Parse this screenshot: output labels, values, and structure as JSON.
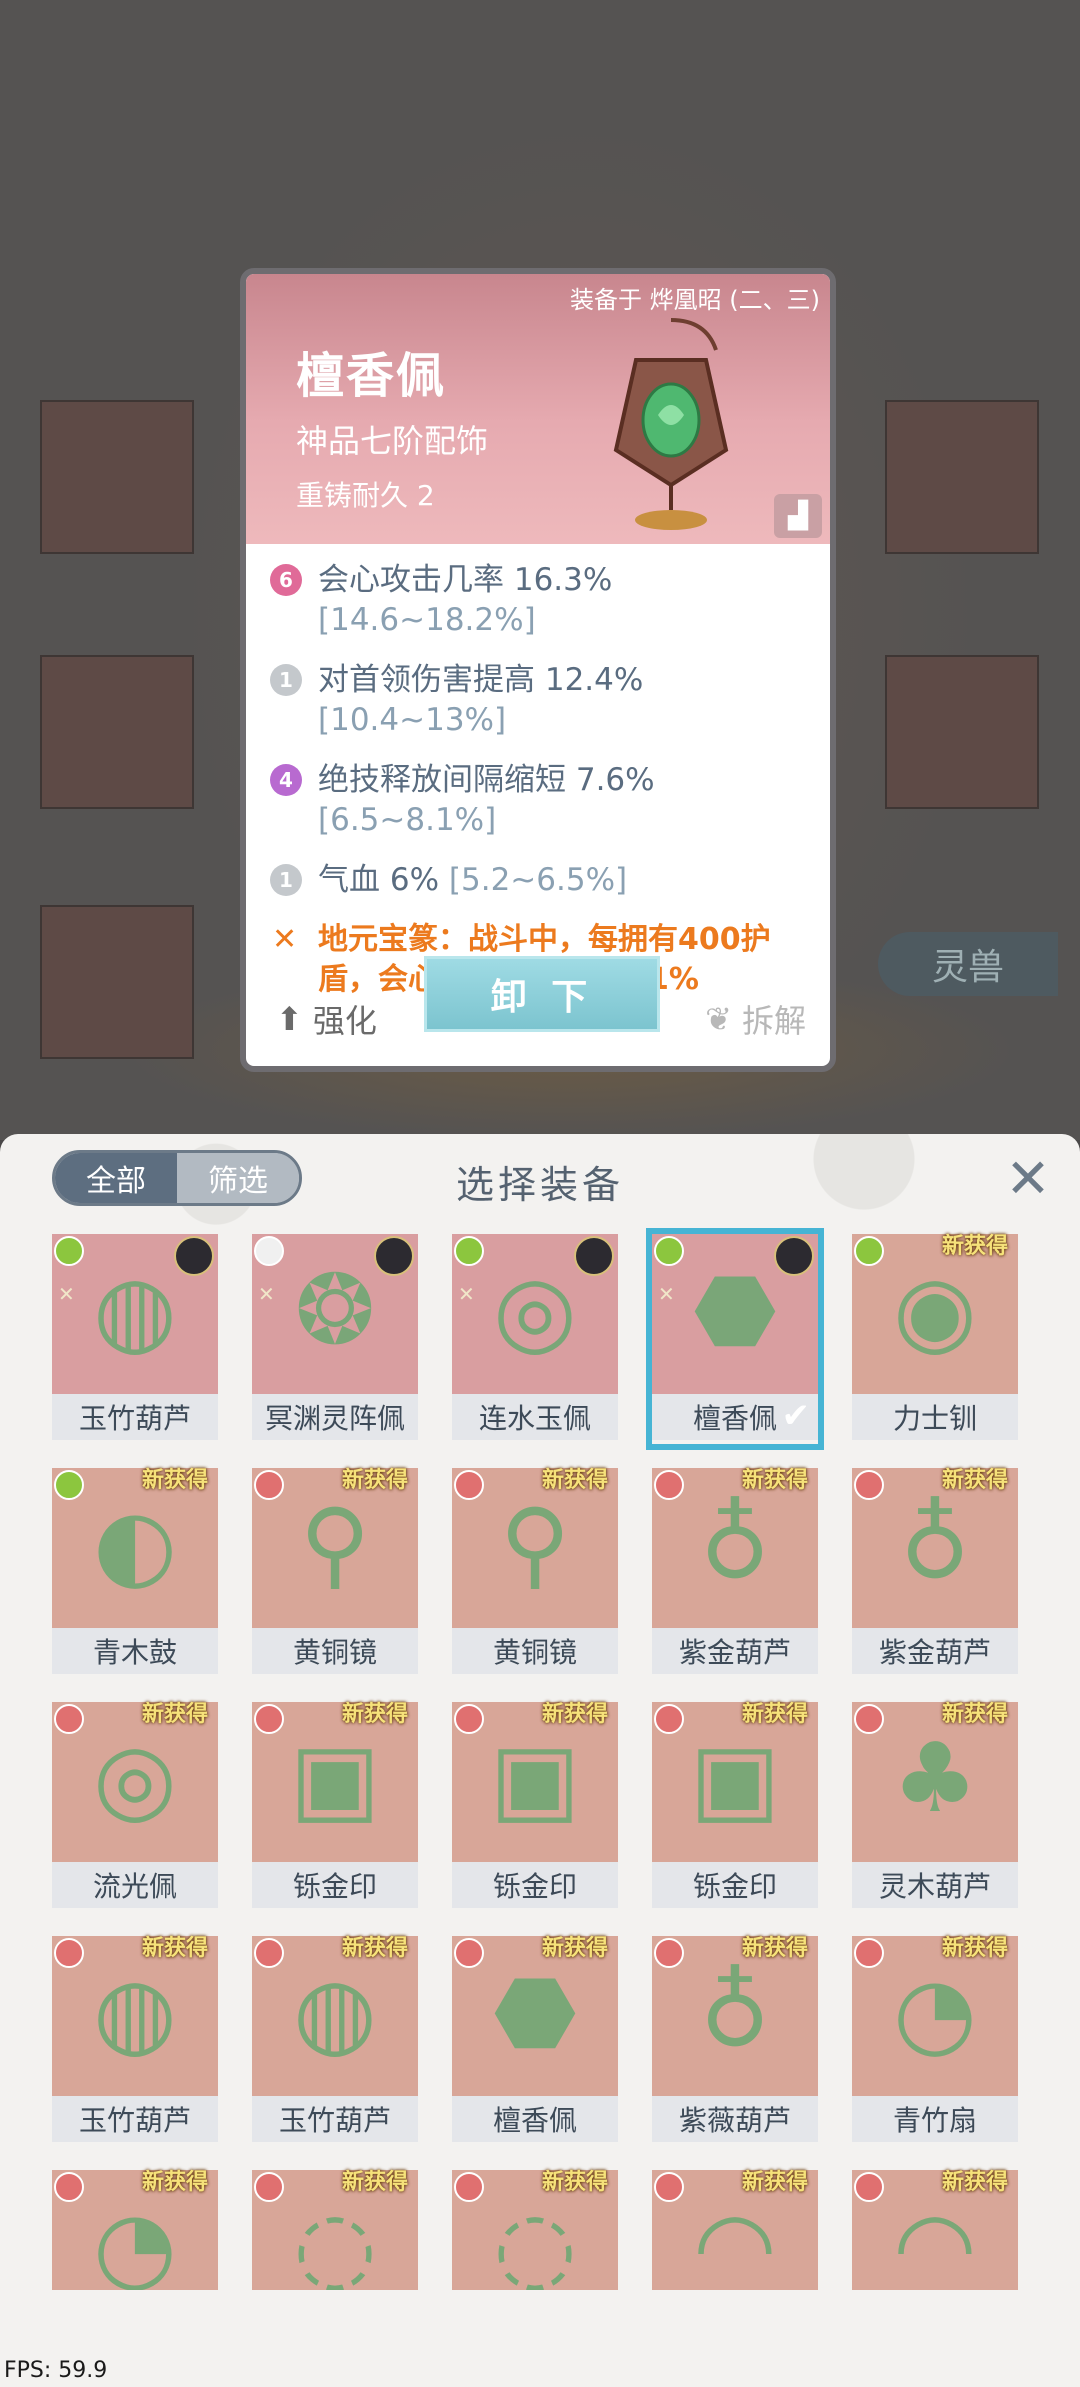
{
  "tooltip": {
    "equipped_on": "装备于 烨凰昭 (二、三)",
    "name": "檀香佩",
    "grade": "神品七阶配饰",
    "reforge": "重铸耐久 2",
    "stats": [
      {
        "badge": "6",
        "badge_color": "#e06a98",
        "label": "会心攻击几率 16.3%",
        "range": "[14.6~18.2%]"
      },
      {
        "badge": "1",
        "badge_color": "#c4c8cc",
        "label": "对首领伤害提高 12.4%",
        "range": "[10.4~13%]"
      },
      {
        "badge": "4",
        "badge_color": "#b86ad0",
        "label": "绝技释放间隔缩短 7.6%",
        "range": "[6.5~8.1%]"
      },
      {
        "badge": "1",
        "badge_color": "#c4c8cc",
        "label": "气血 6%",
        "range": "[5.2~6.5%]"
      }
    ],
    "special_effect": "地元宝篆：战斗中，每拥有400护盾，会心攻击伤害就提高1%",
    "upgrade_label": "强化",
    "unequip_label": "卸 下",
    "dismantle_label": "拆解"
  },
  "background": {
    "side_tab": "灵兽"
  },
  "panel": {
    "tabs": [
      {
        "label": "全部",
        "active": true
      },
      {
        "label": "筛选",
        "active": false
      }
    ],
    "title": "选择装备",
    "close_icon": "close-icon",
    "items": [
      {
        "name": "玉竹葫芦",
        "rarity": "green",
        "avatar": true,
        "new": "",
        "pink": true,
        "selected": false
      },
      {
        "name": "冥渊灵阵佩",
        "rarity": "white",
        "avatar": true,
        "new": "",
        "pink": true,
        "selected": false
      },
      {
        "name": "连水玉佩",
        "rarity": "green",
        "avatar": true,
        "new": "",
        "pink": true,
        "selected": false
      },
      {
        "name": "檀香佩",
        "rarity": "green",
        "avatar": true,
        "new": "",
        "pink": true,
        "selected": true
      },
      {
        "name": "力士钏",
        "rarity": "green",
        "avatar": false,
        "new": "新获得",
        "pink": false,
        "selected": false
      },
      {
        "name": "青木鼓",
        "rarity": "green",
        "avatar": false,
        "new": "新获得",
        "pink": false,
        "selected": false
      },
      {
        "name": "黄铜镜",
        "rarity": "red",
        "avatar": false,
        "new": "新获得",
        "pink": false,
        "selected": false
      },
      {
        "name": "黄铜镜",
        "rarity": "red",
        "avatar": false,
        "new": "新获得",
        "pink": false,
        "selected": false
      },
      {
        "name": "紫金葫芦",
        "rarity": "red",
        "avatar": false,
        "new": "新获得",
        "pink": false,
        "selected": false
      },
      {
        "name": "紫金葫芦",
        "rarity": "red",
        "avatar": false,
        "new": "新获得",
        "pink": false,
        "selected": false
      },
      {
        "name": "流光佩",
        "rarity": "red",
        "avatar": false,
        "new": "新获得",
        "pink": false,
        "selected": false
      },
      {
        "name": "铄金印",
        "rarity": "red",
        "avatar": false,
        "new": "新获得",
        "pink": false,
        "selected": false
      },
      {
        "name": "铄金印",
        "rarity": "red",
        "avatar": false,
        "new": "新获得",
        "pink": false,
        "selected": false
      },
      {
        "name": "铄金印",
        "rarity": "red",
        "avatar": false,
        "new": "新获得",
        "pink": false,
        "selected": false
      },
      {
        "name": "灵木葫芦",
        "rarity": "red",
        "avatar": false,
        "new": "新获得",
        "pink": false,
        "selected": false
      },
      {
        "name": "玉竹葫芦",
        "rarity": "red",
        "avatar": false,
        "new": "新获得",
        "pink": false,
        "selected": false
      },
      {
        "name": "玉竹葫芦",
        "rarity": "red",
        "avatar": false,
        "new": "新获得",
        "pink": false,
        "selected": false
      },
      {
        "name": "檀香佩",
        "rarity": "red",
        "avatar": false,
        "new": "新获得",
        "pink": false,
        "selected": false
      },
      {
        "name": "紫薇葫芦",
        "rarity": "red",
        "avatar": false,
        "new": "新获得",
        "pink": false,
        "selected": false
      },
      {
        "name": "青竹扇",
        "rarity": "red",
        "avatar": false,
        "new": "新获得",
        "pink": false,
        "selected": false
      },
      {
        "name": "",
        "rarity": "red",
        "avatar": false,
        "new": "新获得",
        "pink": false,
        "selected": false
      },
      {
        "name": "",
        "rarity": "red",
        "avatar": false,
        "new": "新获得",
        "pink": false,
        "selected": false
      },
      {
        "name": "",
        "rarity": "red",
        "avatar": false,
        "new": "新获得",
        "pink": false,
        "selected": false
      },
      {
        "name": "",
        "rarity": "red",
        "avatar": false,
        "new": "新获得",
        "pink": false,
        "selected": false
      },
      {
        "name": "",
        "rarity": "red",
        "avatar": false,
        "new": "新获得",
        "pink": false,
        "selected": false
      }
    ]
  },
  "fps": "FPS: 59.9"
}
